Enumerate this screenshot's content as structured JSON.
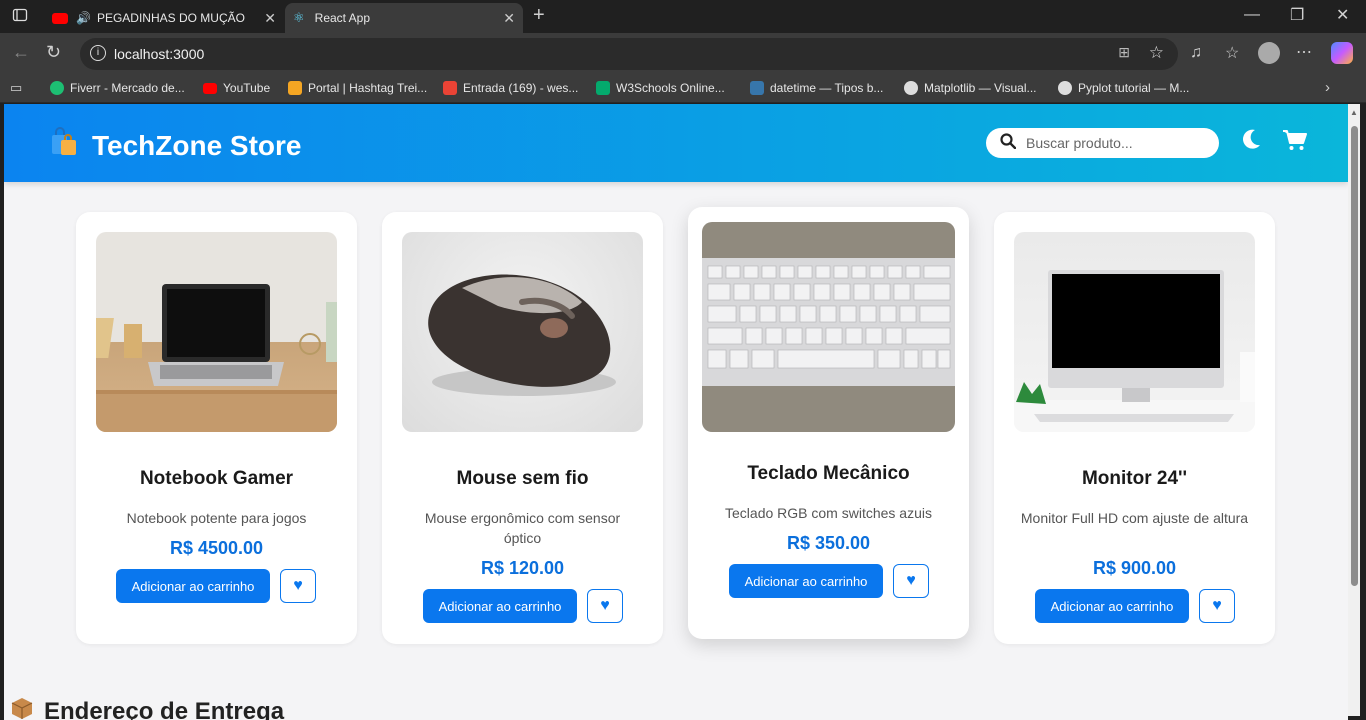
{
  "browser": {
    "tabs": [
      {
        "label": "PEGADINHAS DO MUÇÃO",
        "close": "✕"
      },
      {
        "label": "React App",
        "close": "✕"
      }
    ],
    "new_tab": "+",
    "address": "localhost:3000",
    "bookmarks": [
      {
        "label": "Fiverr - Mercado de...",
        "color": "#1dbf73"
      },
      {
        "label": "YouTube",
        "color": "#ff0000"
      },
      {
        "label": "Portal | Hashtag Trei...",
        "color": "#f5a623"
      },
      {
        "label": "Entrada (169) - wes...",
        "color": "#ea4335"
      },
      {
        "label": "W3Schools Online...",
        "color": "#04aa6d"
      },
      {
        "label": "datetime — Tipos b...",
        "color": "#3776ab"
      },
      {
        "label": "Matplotlib — Visual...",
        "color": "#dddddd"
      },
      {
        "label": "Pyplot tutorial — M...",
        "color": "#dddddd"
      }
    ]
  },
  "header": {
    "brand": "TechZone Store",
    "search_placeholder": "Buscar produto..."
  },
  "products": [
    {
      "name": "Notebook Gamer",
      "desc": "Notebook potente para jogos",
      "price": "R$ 4500.00",
      "button": "Adicionar ao carrinho"
    },
    {
      "name": "Mouse sem fio",
      "desc": "Mouse ergonômico com sensor óptico",
      "price": "R$ 120.00",
      "button": "Adicionar ao carrinho"
    },
    {
      "name": "Teclado Mecânico",
      "desc": "Teclado RGB com switches azuis",
      "price": "R$ 350.00",
      "button": "Adicionar ao carrinho"
    },
    {
      "name": "Monitor 24''",
      "desc": "Monitor Full HD com ajuste de altura",
      "price": "R$ 900.00",
      "button": "Adicionar ao carrinho"
    }
  ],
  "section": {
    "title": "Endereço de Entrega"
  },
  "colors": {
    "accent": "#0a77ee",
    "header_start": "#0b84f0",
    "header_end": "#0ab6da"
  }
}
